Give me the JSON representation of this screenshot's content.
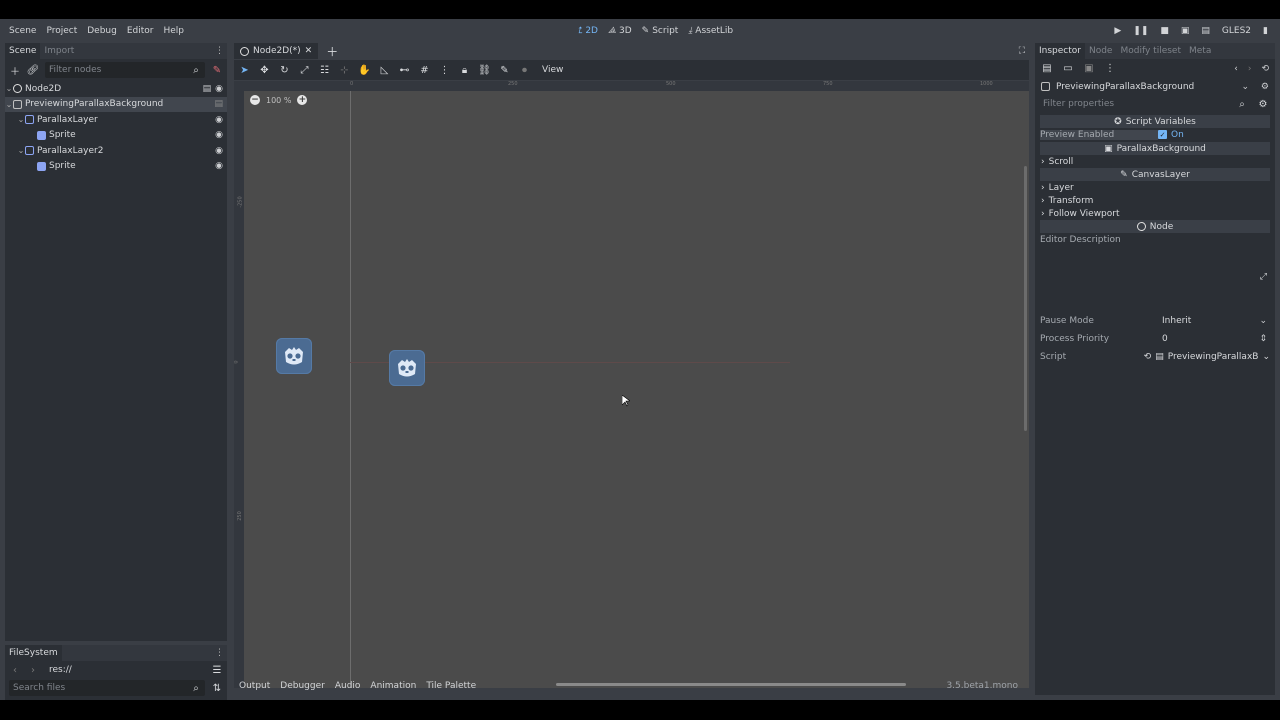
{
  "menu": [
    "Scene",
    "Project",
    "Debug",
    "Editor",
    "Help"
  ],
  "workspaces": [
    {
      "label": "2D",
      "icon": "2d-icon",
      "active": true
    },
    {
      "label": "3D",
      "icon": "3d-icon",
      "active": false
    },
    {
      "label": "Script",
      "icon": "script-icon",
      "active": false
    },
    {
      "label": "AssetLib",
      "icon": "assetlib-icon",
      "active": false
    }
  ],
  "renderer": "GLES2",
  "scene_dock": {
    "tabs": [
      "Scene",
      "Import"
    ],
    "filter_placeholder": "Filter nodes",
    "tree": [
      {
        "label": "Node2D",
        "icon": "node2d-icon"
      },
      {
        "label": "PreviewingParallaxBackground",
        "icon": "parallax-background-icon",
        "selected": true
      },
      {
        "label": "ParallaxLayer",
        "icon": "parallax-layer-icon"
      },
      {
        "label": "Sprite",
        "icon": "sprite-icon"
      },
      {
        "label": "ParallaxLayer2",
        "icon": "parallax-layer-icon"
      },
      {
        "label": "Sprite",
        "icon": "sprite-icon"
      }
    ]
  },
  "filesystem_dock": {
    "tab": "FileSystem",
    "path": "res://",
    "search_placeholder": "Search files",
    "root": "res://"
  },
  "editor": {
    "scene_tab": "Node2D(*)",
    "zoom": "100 %",
    "view_menu": "View",
    "ruler_marks": [
      "0",
      "250",
      "500",
      "750",
      "1000"
    ],
    "ruler_left_marks": [
      "-250",
      "0",
      "250"
    ]
  },
  "bottom_panel": {
    "tabs": [
      "Output",
      "Debugger",
      "Audio",
      "Animation",
      "Tile Palette"
    ],
    "version": "3.5.beta1.mono"
  },
  "inspector": {
    "tabs": [
      "Inspector",
      "Node",
      "Modify tileset",
      "Meta"
    ],
    "object_name": "PreviewingParallaxBackground",
    "filter_placeholder": "Filter properties",
    "sections": {
      "script_variables": "Script Variables",
      "parallax_background": "ParallaxBackground",
      "canvas_layer": "CanvasLayer",
      "node": "Node"
    },
    "preview_enabled": {
      "label": "Preview Enabled",
      "value": "On",
      "checked": true
    },
    "groups_pb": [
      "Scroll"
    ],
    "groups_cl": [
      "Layer",
      "Transform",
      "Follow Viewport"
    ],
    "editor_description": "Editor Description",
    "pause_mode": {
      "label": "Pause Mode",
      "value": "Inherit"
    },
    "process_priority": {
      "label": "Process Priority",
      "value": "0"
    },
    "script": {
      "label": "Script",
      "value": "PreviewingParallaxB"
    }
  }
}
